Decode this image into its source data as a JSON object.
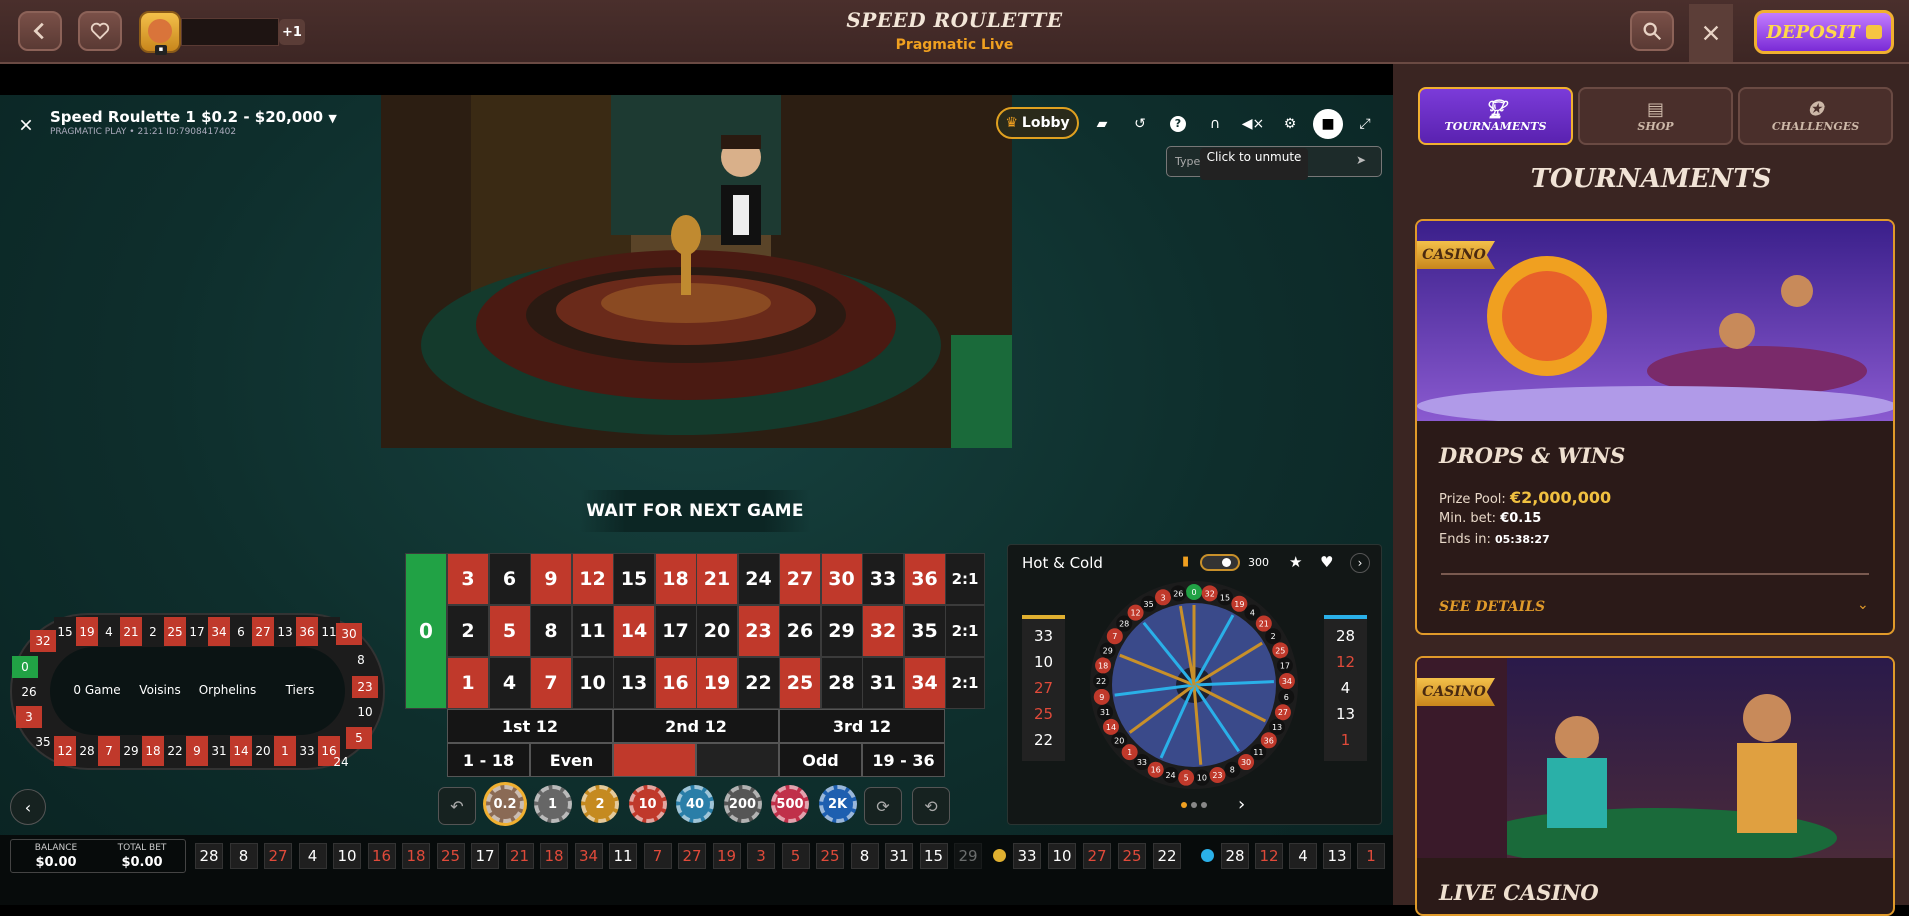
{
  "topbar": {
    "title": "SPEED ROULETTE",
    "subtitle": "Pragmatic Live",
    "plus_badge": "+1",
    "deposit_label": "DEPOSIT",
    "colors": {
      "accent": "#f0a020",
      "deposit": "#7a2bd6"
    }
  },
  "game": {
    "table_title": "Speed Roulette 1 $0.2 - $20,000",
    "table_sub": "PRAGMATIC PLAY • 21:21 ID:7908417402",
    "lobby_label": "Lobby",
    "chat_placeholder": "Type your message...",
    "tooltip": "Click to unmute",
    "status": "WAIT FOR NEXT GAME",
    "grid_rows": [
      [
        {
          "n": "3",
          "c": "red"
        },
        {
          "n": "6",
          "c": "blk"
        },
        {
          "n": "9",
          "c": "red"
        },
        {
          "n": "12",
          "c": "red"
        },
        {
          "n": "15",
          "c": "blk"
        },
        {
          "n": "18",
          "c": "red"
        },
        {
          "n": "21",
          "c": "red"
        },
        {
          "n": "24",
          "c": "blk"
        },
        {
          "n": "27",
          "c": "red"
        },
        {
          "n": "30",
          "c": "red"
        },
        {
          "n": "33",
          "c": "blk"
        },
        {
          "n": "36",
          "c": "red"
        }
      ],
      [
        {
          "n": "2",
          "c": "blk"
        },
        {
          "n": "5",
          "c": "red"
        },
        {
          "n": "8",
          "c": "blk"
        },
        {
          "n": "11",
          "c": "blk"
        },
        {
          "n": "14",
          "c": "red"
        },
        {
          "n": "17",
          "c": "blk"
        },
        {
          "n": "20",
          "c": "blk"
        },
        {
          "n": "23",
          "c": "red"
        },
        {
          "n": "26",
          "c": "blk"
        },
        {
          "n": "29",
          "c": "blk"
        },
        {
          "n": "32",
          "c": "red"
        },
        {
          "n": "35",
          "c": "blk"
        }
      ],
      [
        {
          "n": "1",
          "c": "red"
        },
        {
          "n": "4",
          "c": "blk"
        },
        {
          "n": "7",
          "c": "red"
        },
        {
          "n": "10",
          "c": "blk"
        },
        {
          "n": "13",
          "c": "blk"
        },
        {
          "n": "16",
          "c": "red"
        },
        {
          "n": "19",
          "c": "red"
        },
        {
          "n": "22",
          "c": "blk"
        },
        {
          "n": "25",
          "c": "red"
        },
        {
          "n": "28",
          "c": "blk"
        },
        {
          "n": "31",
          "c": "blk"
        },
        {
          "n": "34",
          "c": "red"
        }
      ]
    ],
    "zero": "0",
    "column_bets": [
      "2:1",
      "2:1",
      "2:1"
    ],
    "dozens": [
      "1st 12",
      "2nd 12",
      "3rd 12"
    ],
    "outside": [
      "1 - 18",
      "Even",
      "",
      "",
      "Odd",
      "19 - 36"
    ],
    "racetrack": {
      "top": [
        "15",
        "19",
        "4",
        "21",
        "2",
        "25",
        "17",
        "34",
        "6",
        "27",
        "13",
        "36",
        "11"
      ],
      "bottom": [
        "12",
        "28",
        "7",
        "29",
        "18",
        "22",
        "9",
        "31",
        "14",
        "20",
        "1",
        "33",
        "16"
      ],
      "left": [
        "32",
        "0",
        "26",
        "3",
        "35"
      ],
      "right": [
        "30",
        "8",
        "23",
        "10",
        "5",
        "24"
      ],
      "sections": [
        "0 Game",
        "Voisins",
        "Orphelins",
        "Tiers"
      ]
    },
    "chips": [
      {
        "label": "0.2",
        "color": "#8a6a55"
      },
      {
        "label": "1",
        "color": "#666666"
      },
      {
        "label": "2",
        "color": "#c58a20"
      },
      {
        "label": "10",
        "color": "#c0392b"
      },
      {
        "label": "40",
        "color": "#2a7ea8"
      },
      {
        "label": "200",
        "color": "#555555"
      },
      {
        "label": "500",
        "color": "#c0304a"
      },
      {
        "label": "2K",
        "color": "#1e5fb0"
      }
    ],
    "hot_cold": {
      "title": "Hot & Cold",
      "rounds": "300",
      "cold": [
        {
          "n": "33",
          "c": "b"
        },
        {
          "n": "10",
          "c": "b"
        },
        {
          "n": "27",
          "c": "r"
        },
        {
          "n": "25",
          "c": "r"
        },
        {
          "n": "22",
          "c": "b"
        }
      ],
      "hot": [
        {
          "n": "28",
          "c": "b"
        },
        {
          "n": "12",
          "c": "r"
        },
        {
          "n": "4",
          "c": "b"
        },
        {
          "n": "13",
          "c": "b"
        },
        {
          "n": "1",
          "c": "r"
        }
      ]
    }
  },
  "bottom": {
    "balance_label": "BALANCE",
    "balance_value": "$0.00",
    "total_bet_label": "TOTAL BET",
    "total_bet_value": "$0.00",
    "history": [
      {
        "n": "28",
        "c": "b"
      },
      {
        "n": "8",
        "c": "b"
      },
      {
        "n": "27",
        "c": "r"
      },
      {
        "n": "4",
        "c": "b"
      },
      {
        "n": "10",
        "c": "b"
      },
      {
        "n": "16",
        "c": "r"
      },
      {
        "n": "18",
        "c": "r"
      },
      {
        "n": "25",
        "c": "r"
      },
      {
        "n": "17",
        "c": "b"
      },
      {
        "n": "21",
        "c": "r"
      },
      {
        "n": "18",
        "c": "r"
      },
      {
        "n": "34",
        "c": "r"
      },
      {
        "n": "11",
        "c": "b"
      },
      {
        "n": "7",
        "c": "r"
      },
      {
        "n": "27",
        "c": "r"
      },
      {
        "n": "19",
        "c": "r"
      },
      {
        "n": "3",
        "c": "r"
      },
      {
        "n": "5",
        "c": "r"
      },
      {
        "n": "25",
        "c": "r"
      },
      {
        "n": "8",
        "c": "b"
      },
      {
        "n": "31",
        "c": "b"
      },
      {
        "n": "15",
        "c": "b"
      },
      {
        "n": "29",
        "c": "b"
      }
    ],
    "cold_strip": [
      {
        "n": "33",
        "c": "b"
      },
      {
        "n": "10",
        "c": "b"
      },
      {
        "n": "27",
        "c": "r"
      },
      {
        "n": "25",
        "c": "r"
      },
      {
        "n": "22",
        "c": "b"
      }
    ],
    "hot_strip": [
      {
        "n": "28",
        "c": "b"
      },
      {
        "n": "12",
        "c": "r"
      },
      {
        "n": "4",
        "c": "b"
      },
      {
        "n": "13",
        "c": "b"
      },
      {
        "n": "1",
        "c": "r"
      }
    ]
  },
  "panel": {
    "tabs": [
      "TOURNAMENTS",
      "SHOP",
      "CHALLENGES"
    ],
    "title": "TOURNAMENTS",
    "cards": [
      {
        "tag": "CASINO",
        "title": "DROPS & WINS",
        "prize_label": "Prize Pool:",
        "prize_value": "€2,000,000",
        "minbet_label": "Min. bet:",
        "minbet_value": "€0.15",
        "ends_label": "Ends in:",
        "ends_value": "05:38:27",
        "details": "SEE DETAILS"
      },
      {
        "tag": "CASINO",
        "title": "LIVE CASINO"
      }
    ]
  }
}
